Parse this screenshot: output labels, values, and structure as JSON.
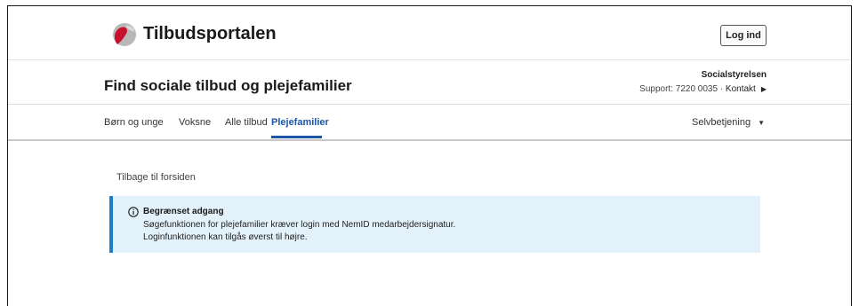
{
  "header": {
    "brand": "Tilbudsportalen",
    "login_label": "Log ind",
    "logo_icon": "tilbudsportalen-logo",
    "logo_colors": [
      "#c8102e",
      "#b8b8b8"
    ]
  },
  "titlebar": {
    "title": "Find sociale tilbud og plejefamilier",
    "organization": "Socialstyrelsen",
    "support_text": "Support: 7220 0035 · ",
    "contact_label": "Kontakt",
    "contact_icon": "triangle-right-icon"
  },
  "nav": {
    "items": [
      {
        "label": "Børn og unge",
        "active": false
      },
      {
        "label": "Voksne",
        "active": false
      },
      {
        "label": "Alle tilbud",
        "active": false
      },
      {
        "label": "Plejefamilier",
        "active": true
      }
    ],
    "selfservice_label": "Selvbetjening",
    "selfservice_icon": "caret-down-icon",
    "active_color": "#1a56a6"
  },
  "content": {
    "back_link": "Tilbage til forsiden",
    "alert": {
      "icon": "info-icon",
      "title": "Begrænset adgang",
      "line1": "Søgefunktionen for plejefamilier kræver login med NemID medarbejdersignatur.",
      "line2": "Loginfunktionen kan tilgås øverst til højre.",
      "background_color": "#e3f2fa",
      "border_color": "#1e7fc7"
    }
  }
}
